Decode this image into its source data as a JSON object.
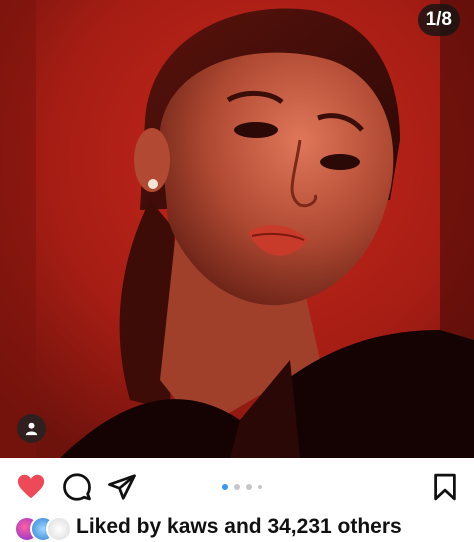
{
  "post": {
    "counter": "1/8",
    "image_icon": "portrait-photo"
  },
  "actions": {
    "like_icon": "heart-icon",
    "comment_icon": "comment-icon",
    "share_icon": "share-icon",
    "save_icon": "bookmark-icon",
    "liked": true,
    "accent": "#ed4956"
  },
  "carousel": {
    "total_dots": 4,
    "active_index": 0,
    "active_color": "#3897f0"
  },
  "likes": {
    "prefix": "Liked by",
    "user": "kaws",
    "joiner": "and",
    "count": "34,231 others"
  }
}
